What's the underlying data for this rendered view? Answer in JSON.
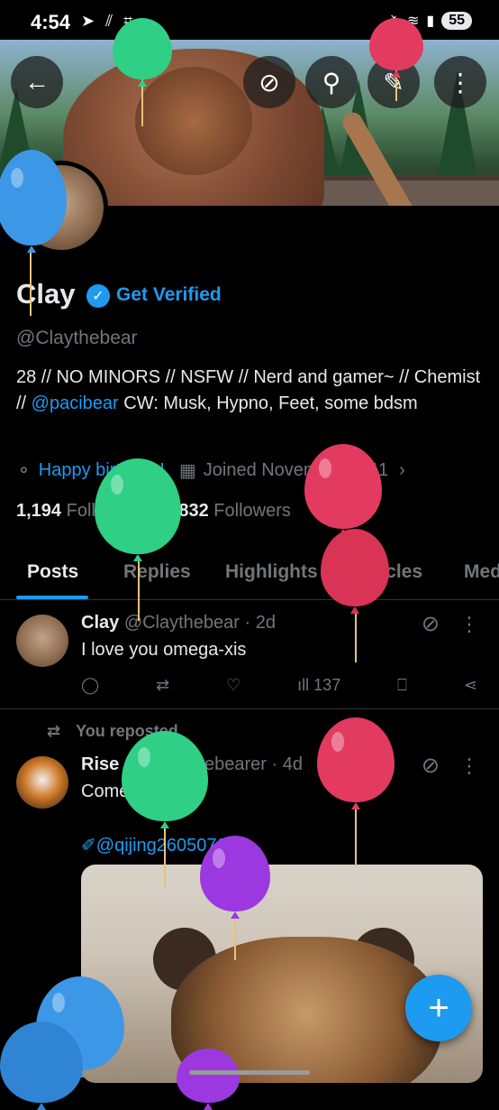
{
  "status_bar": {
    "time": "4:54",
    "battery": "55"
  },
  "header_buttons": [
    "back-icon",
    "grok-icon",
    "search-icon",
    "edit-icon",
    "more-icon"
  ],
  "profile": {
    "name": "Clay",
    "get_verified": "Get Verified",
    "handle": "@Claythebear",
    "bio_prefix": "28 // NO MINORS // NSFW // Nerd and gamer~ // Chemist  // ",
    "bio_mention": "@pacibear",
    "bio_suffix": "  CW: Musk, Hypno, Feet, some bdsm",
    "birthday": "Happy birthday!",
    "joined": "Joined November 2011",
    "following_count": "1,194",
    "following_label": "Following",
    "followers_count": "5,832",
    "followers_label": "Followers"
  },
  "tabs": [
    "Posts",
    "Replies",
    "Highlights",
    "Articles",
    "Media"
  ],
  "posts": [
    {
      "name": "Clay",
      "handle": "@Claythebear",
      "time": "2d",
      "text": "I love you omega-xis",
      "views": "137"
    },
    {
      "repost_label": "You reposted",
      "name": "Rise",
      "handle": "@RiseFatebearer",
      "time": "4d",
      "text": "Come to daddy",
      "link": "@qijing26050760"
    }
  ],
  "colors": {
    "accent": "#1d9bf0",
    "muted": "#71767b",
    "text": "#e7e9ea",
    "background": "#000000"
  }
}
